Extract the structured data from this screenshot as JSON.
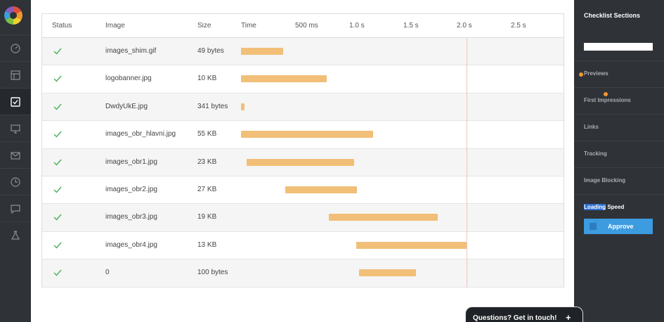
{
  "table": {
    "headers": {
      "status": "Status",
      "image": "Image",
      "size": "Size",
      "time": "Time",
      "ticks": [
        "500 ms",
        "1.0 s",
        "1.5 s",
        "2.0 s",
        "2.5 s"
      ]
    },
    "rows": [
      {
        "image": "images_shim.gif",
        "size": "49 bytes",
        "start": 0.0,
        "end": 0.39
      },
      {
        "image": "logobanner.jpg",
        "size": "10 KB",
        "start": 0.0,
        "end": 0.8
      },
      {
        "image": "DwdyUkE.jpg",
        "size": "341 bytes",
        "start": 0.0,
        "end": 0.03
      },
      {
        "image": "images_obr_hlavni.jpg",
        "size": "55 KB",
        "start": 0.0,
        "end": 1.23
      },
      {
        "image": "images_obr1.jpg",
        "size": "23 KB",
        "start": 0.05,
        "end": 1.05
      },
      {
        "image": "images_obr2.jpg",
        "size": "27 KB",
        "start": 0.41,
        "end": 1.08
      },
      {
        "image": "images_obr3.jpg",
        "size": "19 KB",
        "start": 0.82,
        "end": 1.83
      },
      {
        "image": "images_obr4.jpg",
        "size": "13 KB",
        "start": 1.07,
        "end": 2.1
      },
      {
        "image": "0",
        "size": "100 bytes",
        "start": 1.1,
        "end": 1.63
      }
    ],
    "marker_time": 2.1
  },
  "sidebar": {
    "title": "Checklist Sections",
    "search_value": "",
    "items": [
      "Previews",
      "First Impressions",
      "Links",
      "Tracking",
      "Image Blocking"
    ],
    "current_prefix": "Loading",
    "current_suffix": " Speed",
    "approve_label": "Approve"
  },
  "contact": {
    "label": "Questions? Get in touch!",
    "plus": "+"
  },
  "colors": {
    "bar": "#f1bf78",
    "check": "#4cae5a",
    "accent": "#3d9be0",
    "dot": "#f0962e"
  },
  "icons": [
    "logo-icon",
    "dashboard-icon",
    "layout-icon",
    "checklist-icon",
    "monitor-icon",
    "mail-icon",
    "clock-icon",
    "chat-icon",
    "flask-icon"
  ]
}
